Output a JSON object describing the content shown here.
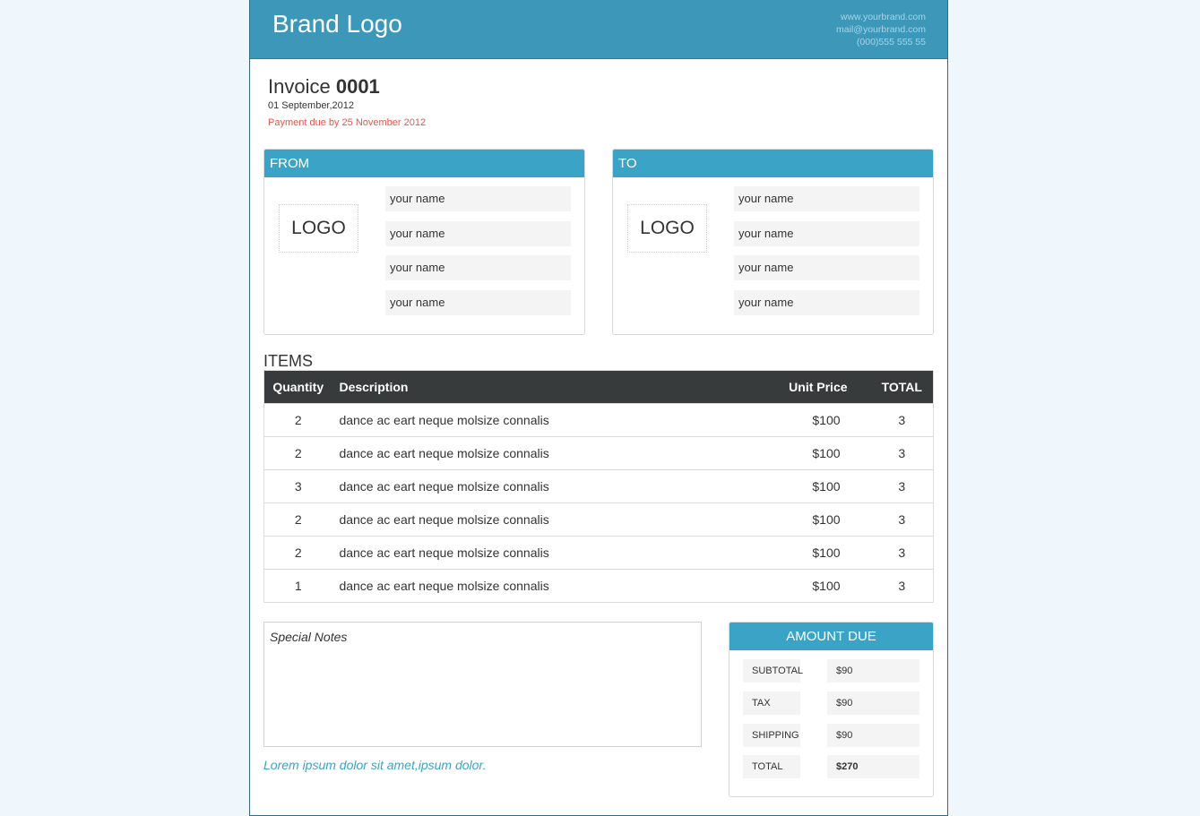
{
  "header": {
    "brand": "Brand Logo",
    "website": "www.yourbrand.com",
    "email": "mail@yourbrand.com",
    "phone": "(000)555 555 55"
  },
  "invoice": {
    "label": "Invoice",
    "number": "0001",
    "date": "01 September,2012",
    "due": "Payment due by 25 November 2012"
  },
  "from": {
    "title": "FROM",
    "logo": "LOGO",
    "fields": [
      "your name",
      "your name",
      "your name",
      "your name"
    ]
  },
  "to": {
    "title": "TO",
    "logo": "LOGO",
    "fields": [
      "your name",
      "your name",
      "your name",
      "your name"
    ]
  },
  "items": {
    "heading": "ITEMS",
    "columns": [
      "Quantity",
      "Description",
      "Unit Price",
      "TOTAL"
    ],
    "rows": [
      {
        "qty": "2",
        "desc": "dance ac eart neque molsize connalis",
        "price": "$100",
        "total": "3"
      },
      {
        "qty": "2",
        "desc": "dance ac eart neque molsize connalis",
        "price": "$100",
        "total": "3"
      },
      {
        "qty": "3",
        "desc": "dance ac eart neque molsize connalis",
        "price": "$100",
        "total": "3"
      },
      {
        "qty": "2",
        "desc": "dance ac eart neque molsize connalis",
        "price": "$100",
        "total": "3"
      },
      {
        "qty": "2",
        "desc": "dance ac eart neque molsize connalis",
        "price": "$100",
        "total": "3"
      },
      {
        "qty": "1",
        "desc": "dance ac eart neque molsize connalis",
        "price": "$100",
        "total": "3"
      }
    ]
  },
  "notes": {
    "label": "Special Notes",
    "footer": "Lorem ipsum dolor sit amet,ipsum dolor."
  },
  "amount_due": {
    "title": "AMOUNT DUE",
    "rows": [
      {
        "label": "SUBTOTAL",
        "value": "$90"
      },
      {
        "label": "TAX",
        "value": "$90"
      },
      {
        "label": "SHIPPING",
        "value": "$90"
      },
      {
        "label": "TOTAL",
        "value": "$270"
      }
    ]
  },
  "colors": {
    "brand_bar": "#3c97b9",
    "section_header": "#3ba3c6",
    "table_header": "#383b3c",
    "due_text": "#e0584f"
  }
}
